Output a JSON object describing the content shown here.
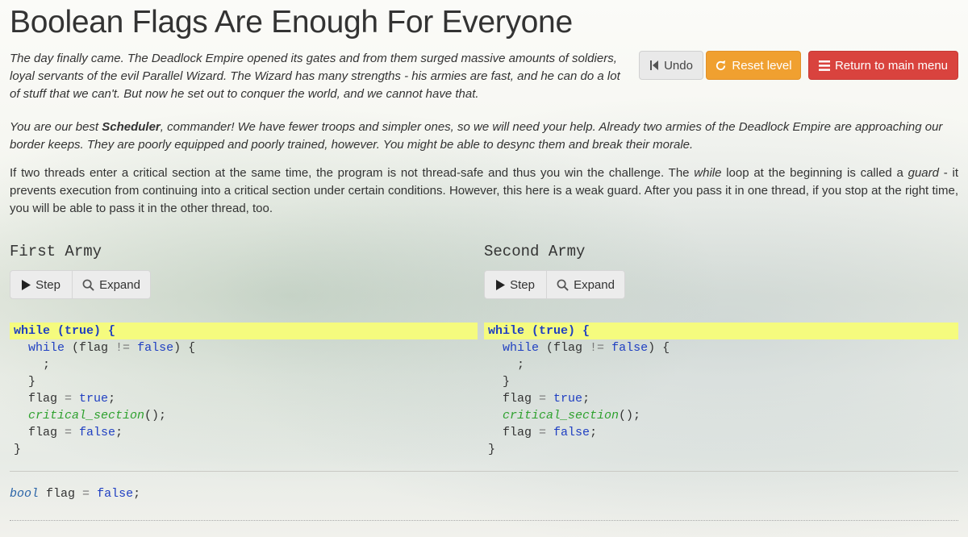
{
  "page": {
    "title": "Boolean Flags Are Enough For Everyone",
    "intro": "The day finally came. The Deadlock Empire opened its gates and from them surged massive amounts of soldiers, loyal servants of the evil Parallel Wizard. The Wizard has many strengths - his armies are fast, and he can do a lot of stuff that we can't. But now he set out to conquer the world, and we cannot have that.",
    "intro2_pre": "You are our best ",
    "intro2_bold": "Scheduler",
    "intro2_post": ", commander! We have fewer troops and simpler ones, so we will need your help. Already two armies of the Deadlock Empire are approaching our border keeps. They are poorly equipped and poorly trained, however. You might be able to desync them and break their morale.",
    "desc_1": "If two threads enter a critical section at the same time, the program is not thread-safe and thus you win the challenge. The ",
    "desc_while": "while",
    "desc_2": " loop at the beginning is called a ",
    "desc_guard": "guard",
    "desc_3": " - it prevents execution from continuing into a critical section under certain conditions. However, this here is a weak guard. After you pass it in one thread, if you stop at the right time, you will be able to pass it in the other thread, too."
  },
  "toolbar": {
    "undo_label": "Undo",
    "reset_label": "Reset level",
    "menu_label": "Return to main menu"
  },
  "threads": [
    {
      "title": "First Army",
      "step_label": "Step",
      "expand_label": "Expand"
    },
    {
      "title": "Second Army",
      "step_label": "Step",
      "expand_label": "Expand"
    }
  ],
  "code": {
    "l1_kw": "while",
    "l1_open": " (",
    "l1_true": "true",
    "l1_close": ") {",
    "l2_kw": "while",
    "l2_a": " (flag ",
    "l2_op": "!=",
    "l2_sp": " ",
    "l2_false": "false",
    "l2_b": ") {",
    "l3": ";",
    "l4": "}",
    "l5_a": "flag ",
    "l5_op": "=",
    "l5_sp": " ",
    "l5_val": "true",
    "l5_semi": ";",
    "l6_fn": "critical_section",
    "l6_b": "();",
    "l7_a": "flag ",
    "l7_op": "=",
    "l7_sp": " ",
    "l7_val": "false",
    "l7_semi": ";",
    "l8": "}"
  },
  "globals": {
    "type": "bool",
    "name": " flag ",
    "op": "=",
    "sp": " ",
    "val": "false",
    "semi": ";"
  },
  "colors": {
    "highlight": "#f5fb7e",
    "keyword": "#1f3fc2",
    "function": "#2fa12f",
    "reset": "#f0a030",
    "menu": "#d9433e"
  }
}
